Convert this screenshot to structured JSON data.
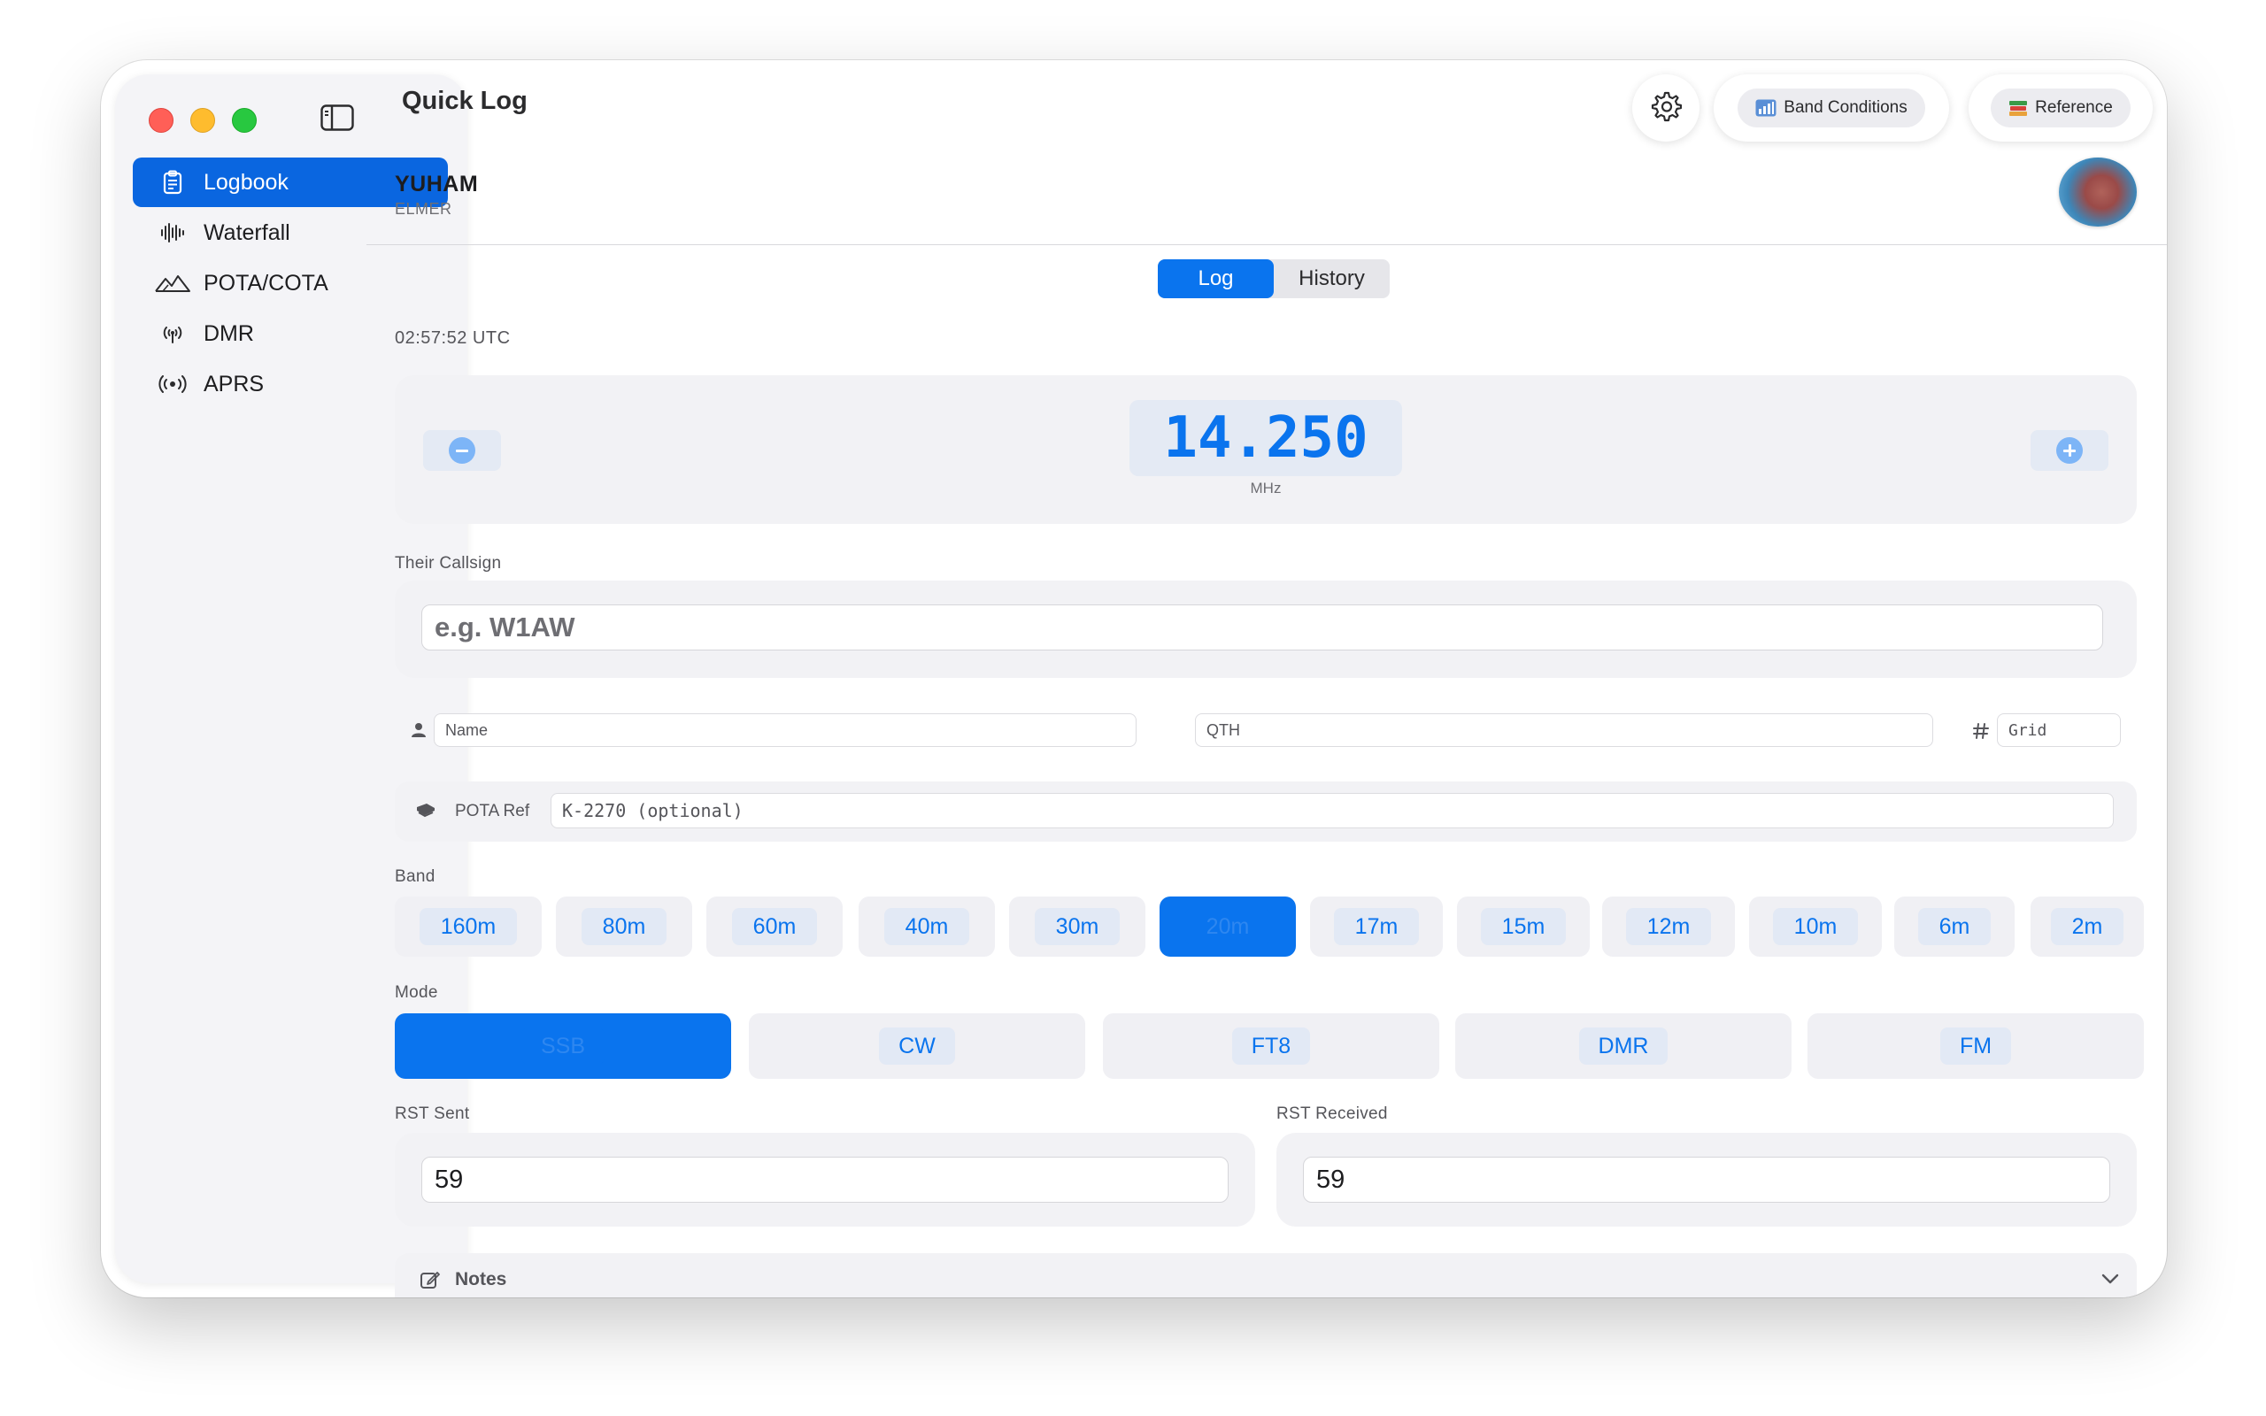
{
  "window": {
    "title": "Quick Log"
  },
  "sidebar": {
    "items": [
      {
        "label": "Logbook",
        "icon": "clipboard-icon",
        "active": true
      },
      {
        "label": "Waterfall",
        "icon": "waveform-icon"
      },
      {
        "label": "POTA/COTA",
        "icon": "mountains-icon"
      },
      {
        "label": "DMR",
        "icon": "antenna-icon"
      },
      {
        "label": "APRS",
        "icon": "broadcast-icon"
      }
    ]
  },
  "toolbar": {
    "band_conditions_label": "Band Conditions",
    "reference_label": "Reference"
  },
  "user": {
    "callsign": "YUHAM",
    "role": "ELMER"
  },
  "tabs": [
    {
      "label": "Log",
      "active": true
    },
    {
      "label": "History"
    }
  ],
  "time": "02:57:52 UTC",
  "frequency": {
    "value": "14.250",
    "unit": "MHz"
  },
  "their_callsign": {
    "label": "Their Callsign",
    "placeholder": "e.g. W1AW"
  },
  "fields": {
    "name_placeholder": "Name",
    "qth_placeholder": "QTH",
    "grid_placeholder": "Grid",
    "pota_label": "POTA Ref",
    "pota_placeholder": "K-2270 (optional)"
  },
  "band": {
    "label": "Band",
    "options": [
      "160m",
      "80m",
      "60m",
      "40m",
      "30m",
      "20m",
      "17m",
      "15m",
      "12m",
      "10m",
      "6m",
      "2m"
    ],
    "selected": "20m"
  },
  "mode": {
    "label": "Mode",
    "options": [
      "SSB",
      "CW",
      "FT8",
      "DMR",
      "FM"
    ],
    "selected": "SSB"
  },
  "rst": {
    "sent_label": "RST Sent",
    "sent_value": "59",
    "received_label": "RST Received",
    "received_value": "59"
  },
  "notes": {
    "label": "Notes"
  },
  "colors": {
    "accent": "#0a74ee",
    "sidebar_active": "#0a66e0"
  }
}
